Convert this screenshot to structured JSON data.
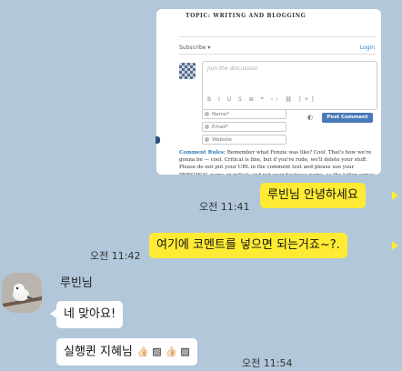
{
  "screenshot": {
    "topic": "TOPIC: WRITING AND BLOGGING",
    "subscribe": "Subscribe ▾",
    "login": "Login",
    "placeholder": "Join the discussion",
    "toolbar": "B I U S ⊞ ❝ ‹› ⛓ [+]",
    "name_field": "Name*",
    "email_field": "Email*",
    "website_field": "Website",
    "post_button": "Post Comment",
    "rules_label": "Comment Rules:",
    "rules_text": "Remember what Fonzie was like? Cool. That's how we're gonna be — cool. Critical is fine, but if you're rude, we'll delete your stuff. Please do not put your URL in the comment text and please use your PERSONAL name or initials and not your business name, as the latter comes off like spam. Have fun and thanks for adding to the conversation! (Thanks to Brian Oberkirch for the inspiration.)"
  },
  "messages": [
    {
      "text": "루빈님 안녕하세요",
      "time": "오전 11:41",
      "side": "right"
    },
    {
      "text": "여기에 코멘트를 넣으면 되는거죠~?.",
      "time": "오전 11:42",
      "side": "right"
    },
    {
      "sender": "루빈님"
    },
    {
      "text": "네 맞아요!",
      "side": "left"
    },
    {
      "text": "실행퀸 지혜님",
      "time": "오전 11:54",
      "side": "left",
      "emoji": "👍🏻 ▨ 👍🏻 ▨"
    }
  ],
  "colors": {
    "background": "#b2c7d9",
    "my_bubble": "#ffeb33",
    "their_bubble": "#ffffff"
  }
}
